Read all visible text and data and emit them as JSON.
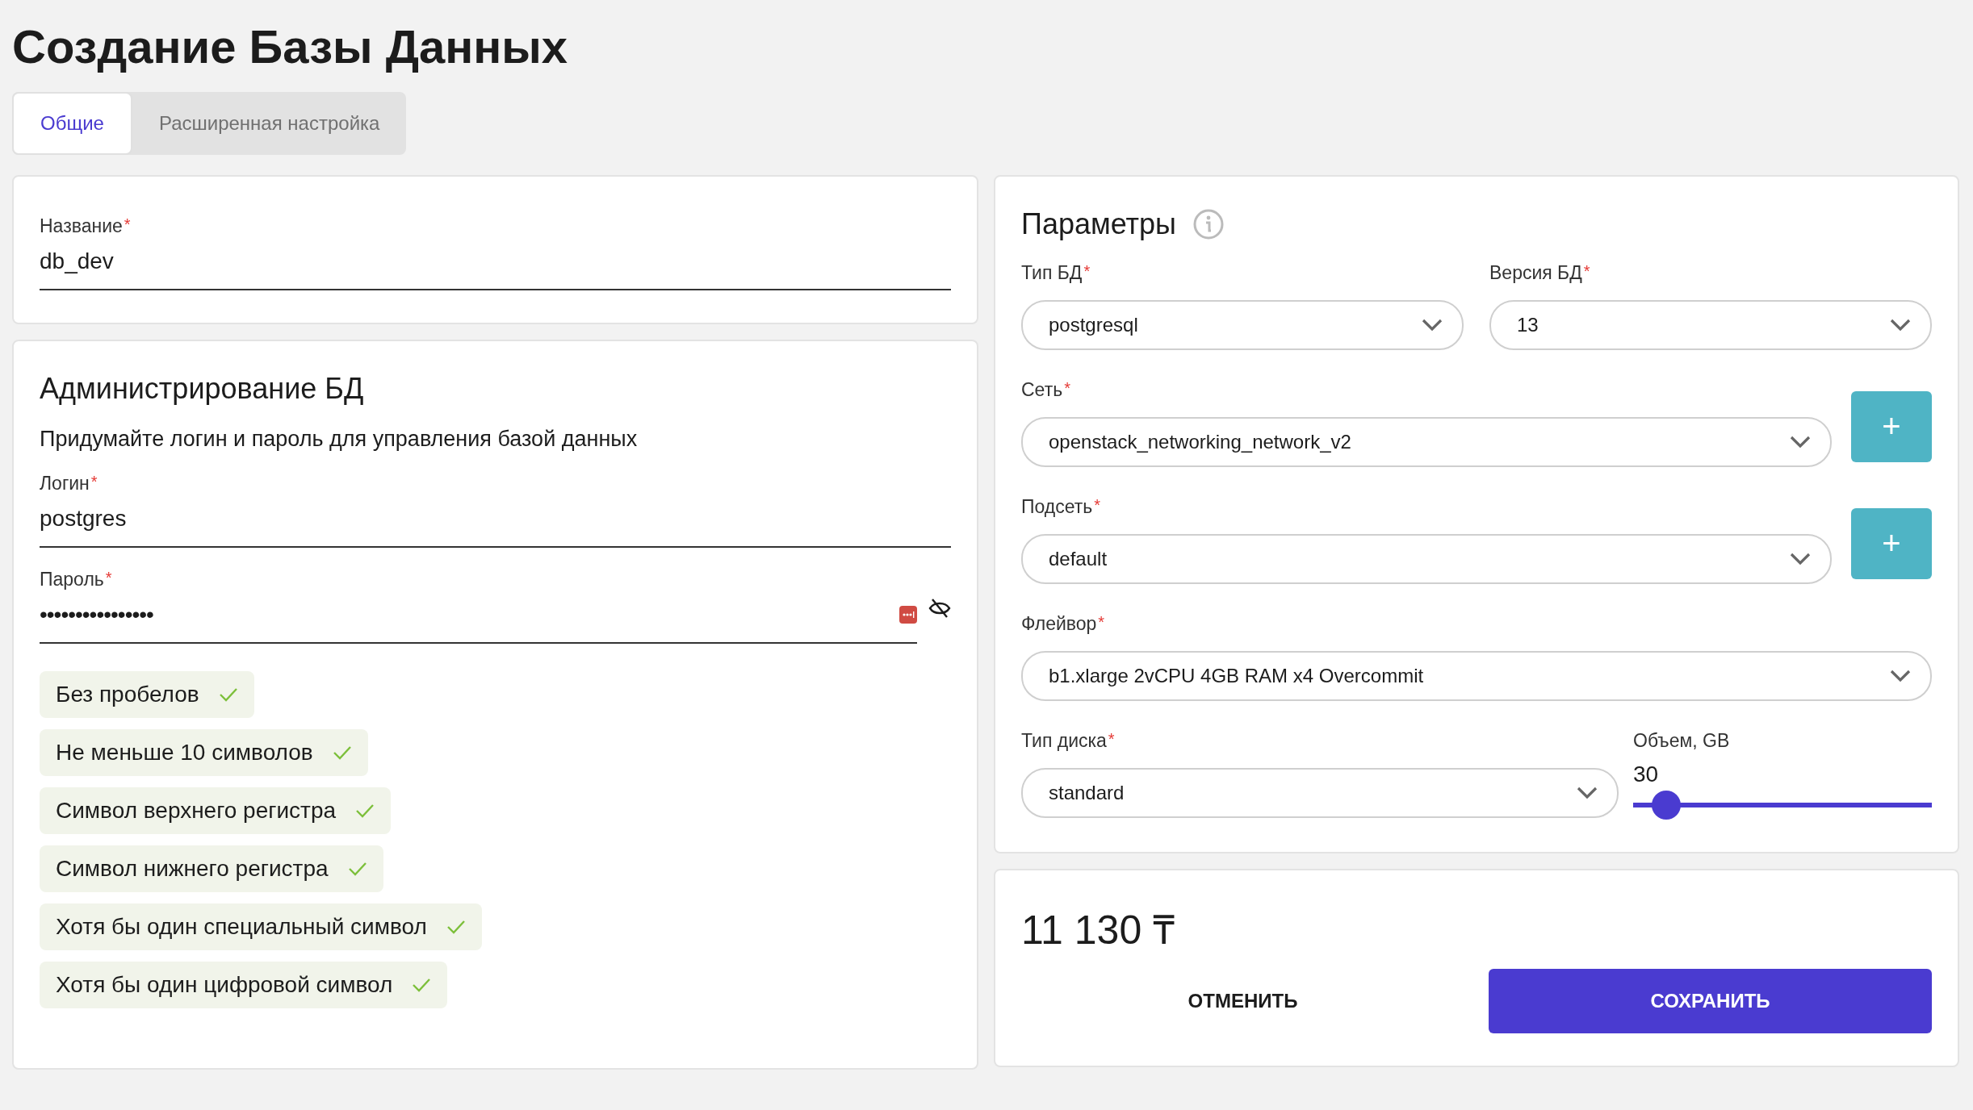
{
  "page_title": "Создание Базы Данных",
  "tabs": [
    {
      "label": "Общие",
      "selected": true
    },
    {
      "label": "Расширенная настройка",
      "selected": false
    }
  ],
  "name_field": {
    "label": "Название",
    "required_mark": "*",
    "value": "db_dev"
  },
  "admin": {
    "title": "Администрирование БД",
    "description": "Придумайте логин и пароль для управления базой данных",
    "login": {
      "label": "Логин",
      "required_mark": "*",
      "value": "postgres"
    },
    "password": {
      "label": "Пароль",
      "required_mark": "*",
      "value": "••••••••••••••••",
      "hidden": true
    },
    "requirements": [
      {
        "text": "Без пробелов",
        "met": true
      },
      {
        "text": "Не меньше 10 символов",
        "met": true
      },
      {
        "text": "Символ верхнего регистра",
        "met": true
      },
      {
        "text": "Символ нижнего регистра",
        "met": true
      },
      {
        "text": "Хотя бы один специальный символ",
        "met": true
      },
      {
        "text": "Хотя бы один цифровой символ",
        "met": true
      }
    ]
  },
  "parameters": {
    "title": "Параметры",
    "db_type": {
      "label": "Тип БД",
      "required_mark": "*",
      "value": "postgresql"
    },
    "db_version": {
      "label": "Версия БД",
      "required_mark": "*",
      "value": "13"
    },
    "network": {
      "label": "Сеть",
      "required_mark": "*",
      "value": "openstack_networking_network_v2",
      "add_button": "+"
    },
    "subnet": {
      "label": "Подсеть",
      "required_mark": "*",
      "value": "default",
      "add_button": "+"
    },
    "flavor": {
      "label": "Флейвор",
      "required_mark": "*",
      "value": "b1.xlarge 2vCPU 4GB RAM x4 Overcommit"
    },
    "disk_type": {
      "label": "Тип диска",
      "required_mark": "*",
      "value": "standard"
    },
    "volume": {
      "label": "Объем, GB",
      "reading": "30",
      "level": 0.07
    }
  },
  "summary": {
    "price": "11 130 ₸",
    "cancel": "ОТМЕНИТЬ",
    "save": "СОХРАНИТЬ"
  }
}
